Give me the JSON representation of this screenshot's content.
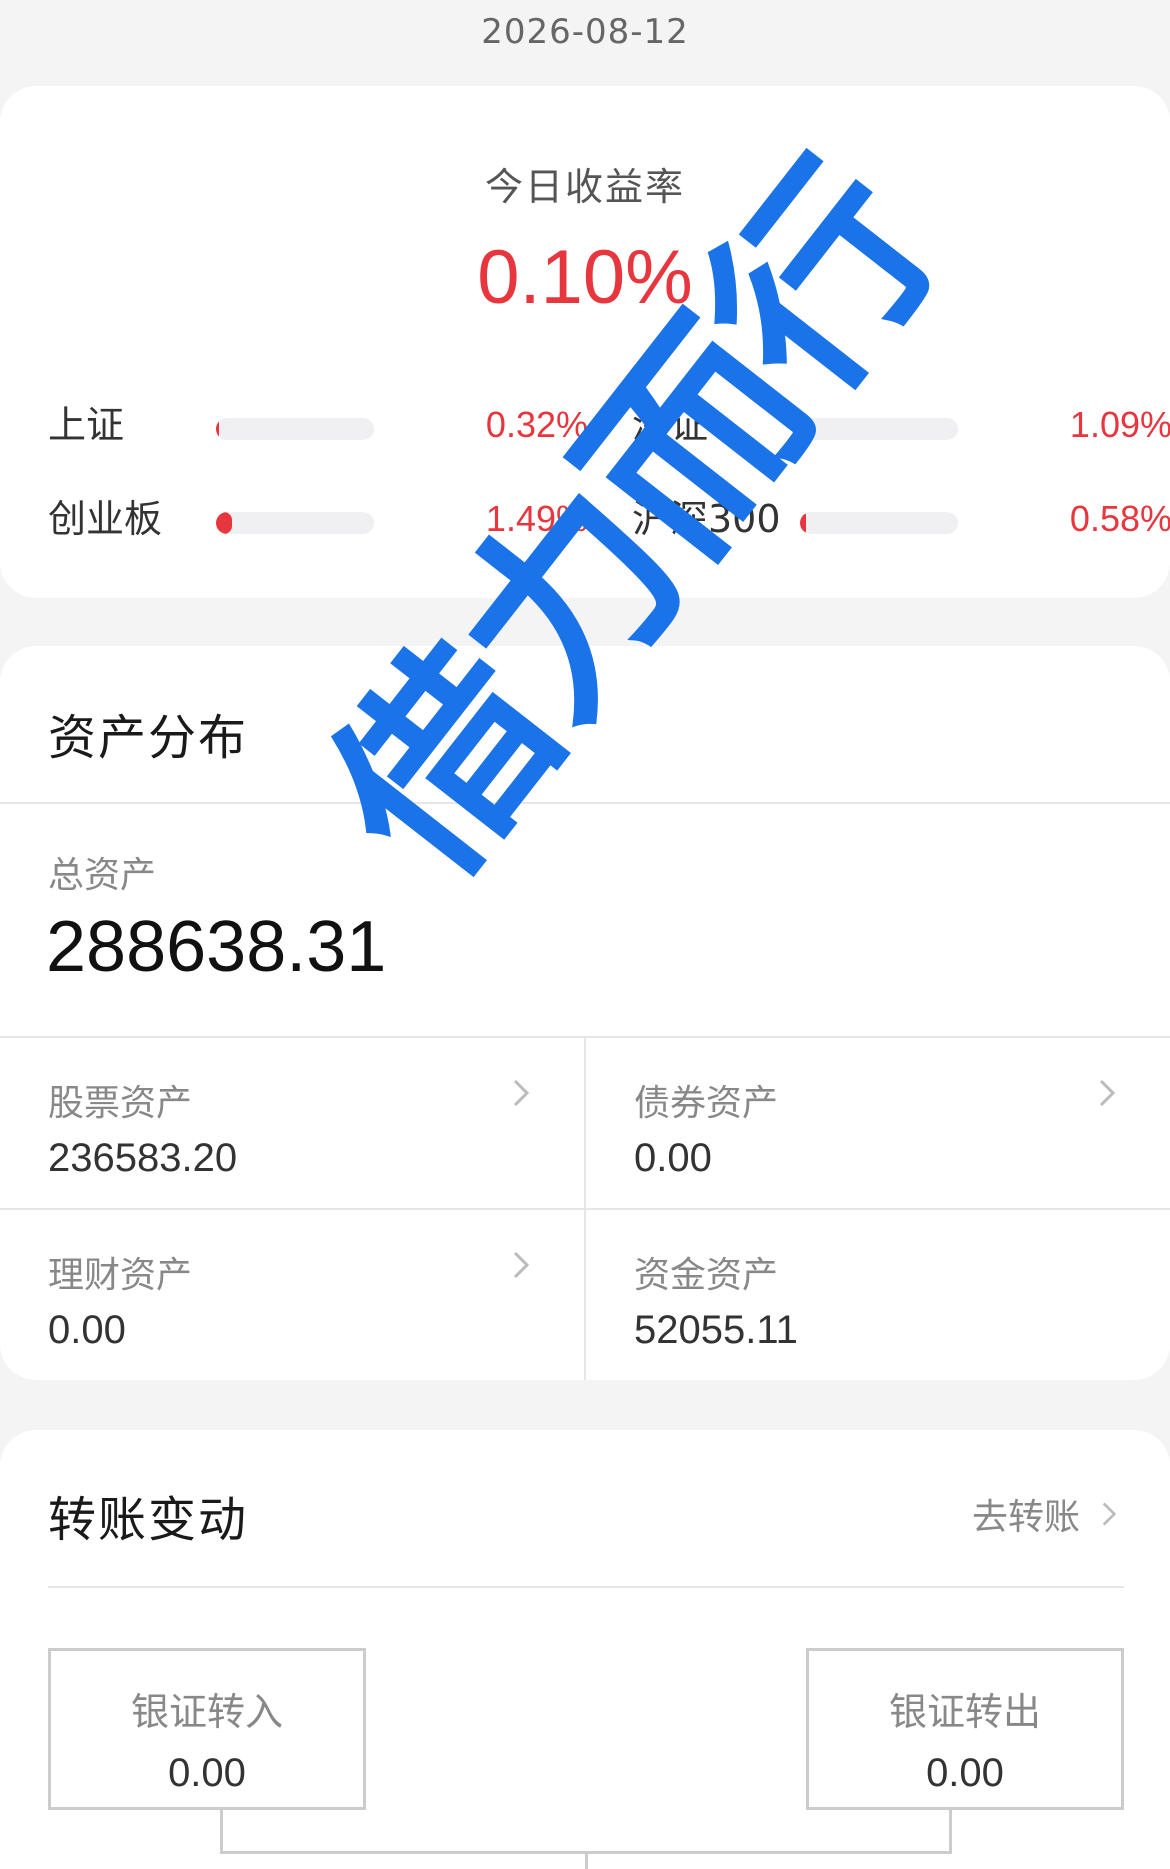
{
  "date": "2026-08-12",
  "today_return": {
    "label": "今日收益率",
    "value": "0.10%",
    "accent_color": "#e8363e"
  },
  "indices": [
    {
      "name": "上证",
      "value": "0.32%",
      "bar_fraction": 0.02
    },
    {
      "name": "深证",
      "value": "1.09%",
      "bar_fraction": 0.07
    },
    {
      "name": "创业板",
      "value": "1.49%",
      "bar_fraction": 0.1
    },
    {
      "name": "沪深300",
      "value": "0.58%",
      "bar_fraction": 0.04
    }
  ],
  "assets": {
    "title": "资产分布",
    "total_label": "总资产",
    "total_value": "288638.31",
    "cells": [
      {
        "label": "股票资产",
        "value": "236583.20",
        "has_chevron": true
      },
      {
        "label": "债券资产",
        "value": "0.00",
        "has_chevron": true
      },
      {
        "label": "理财资产",
        "value": "0.00",
        "has_chevron": true
      },
      {
        "label": "资金资产",
        "value": "52055.11",
        "has_chevron": false
      }
    ]
  },
  "transfer": {
    "title": "转账变动",
    "goto_label": "去转账",
    "bank_in_label": "银证转入",
    "bank_in_value": "0.00",
    "bank_out_label": "银证转出",
    "bank_out_value": "0.00"
  },
  "watermark": "借力而行",
  "watermark_color": "#1a73e8"
}
